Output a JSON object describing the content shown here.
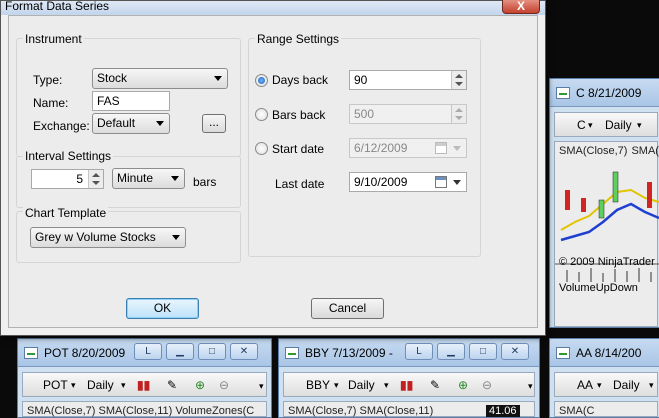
{
  "dialog": {
    "title": "Format Data Series",
    "close_label": "X",
    "instrument": {
      "group_label": "Instrument",
      "type_label": "Type:",
      "type_value": "Stock",
      "name_label": "Name:",
      "name_value": "FAS",
      "exchange_label": "Exchange:",
      "exchange_value": "Default",
      "browse_label": "..."
    },
    "interval": {
      "group_label": "Interval Settings",
      "value": "5",
      "unit": "Minute",
      "suffix": "bars"
    },
    "template": {
      "group_label": "Chart Template",
      "value": "Grey w Volume Stocks"
    },
    "range": {
      "group_label": "Range Settings",
      "days_back_label": "Days back",
      "days_back_value": "90",
      "bars_back_label": "Bars back",
      "bars_back_value": "500",
      "start_date_label": "Start date",
      "start_date_value": "6/12/2009",
      "last_date_label": "Last date",
      "last_date_value": "9/10/2009"
    },
    "ok_label": "OK",
    "cancel_label": "Cancel"
  },
  "charts": {
    "c": {
      "title": "C  8/21/2009",
      "symbol": "C",
      "interval": "Daily",
      "indicator_1": "SMA(Close,7)",
      "indicator_2": "SMA(",
      "copyright": "© 2009 NinjaTrader",
      "indicator_bottom": "VolumeUpDown"
    },
    "pot": {
      "title": "POT  8/20/2009",
      "symbol": "POT",
      "interval": "Daily",
      "indicators": "SMA(Close,7)  SMA(Close,11)  VolumeZones(C"
    },
    "bby": {
      "title": "BBY  7/13/2009 -",
      "symbol": "BBY",
      "interval": "Daily",
      "indicators": "SMA(Close,7)  SMA(Close,11)",
      "price_badge": "41.06"
    },
    "aa": {
      "title": "AA  8/14/200",
      "symbol": "AA",
      "interval": "Daily",
      "indicators": "SMA(C"
    },
    "caption_btn_label": "L",
    "min_icon": "minimize-icon",
    "max_icon": "maximize-icon",
    "close_icon": "close-icon"
  }
}
